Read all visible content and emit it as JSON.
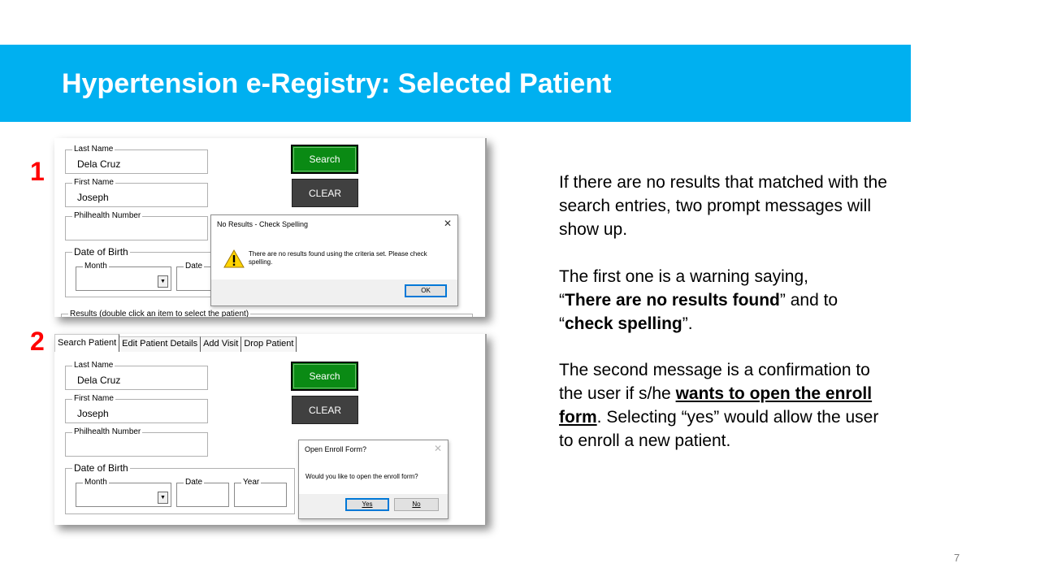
{
  "slide": {
    "title": "Hypertension e-Registry: Selected Patient",
    "page_number": "7",
    "colors": {
      "title_band": "#00b0f0",
      "step_number": "#ff0000"
    }
  },
  "steps": [
    {
      "number": "1"
    },
    {
      "number": "2"
    }
  ],
  "shot1": {
    "last_name_label": "Last Name",
    "last_name_value": "Dela Cruz",
    "first_name_label": "First Name",
    "first_name_value": "Joseph",
    "philhealth_label": "Philhealth Number",
    "dob_label": "Date of Birth",
    "month_label": "Month",
    "date_label": "Date",
    "search_label": "Search",
    "clear_label": "CLEAR",
    "results_label": "Results (double click an item to select the patient)",
    "dialog": {
      "title": "No Results - Check Spelling",
      "close": "✕",
      "icon": "warning-icon",
      "message": "There are no results found using the criteria set. Please check spelling.",
      "ok_label": "OK"
    }
  },
  "shot2": {
    "tabs": [
      "Search Patient",
      "Edit Patient Details",
      "Add Visit",
      "Drop Patient"
    ],
    "last_name_label": "Last Name",
    "last_name_value": "Dela Cruz",
    "first_name_label": "First Name",
    "first_name_value": "Joseph",
    "philhealth_label": "Philhealth Number",
    "dob_label": "Date of Birth",
    "month_label": "Month",
    "date_label": "Date",
    "year_label": "Year",
    "search_label": "Search",
    "clear_label": "CLEAR",
    "dialog": {
      "title": "Open Enroll Form?",
      "close": "✕",
      "message": "Would you like to open the enroll form?",
      "yes_label": "Yes",
      "no_label": "No"
    }
  },
  "description": {
    "p1": "If there are no results that matched with the search entries, two prompt messages will show up.",
    "p2_a": "The first one is a warning saying,",
    "p2_q1_open": "“",
    "p2_b": "There are no results found",
    "p2_c": "” and to",
    "p2_q2_open": "“",
    "p2_d": "check spelling",
    "p2_e": "”.",
    "p3_a": "The second message is a confirmation to the user if s/he",
    "p3_b": "wants to open the enroll form",
    "p3_c": ". Selecting “yes” would allow the user to enroll a new patient."
  }
}
